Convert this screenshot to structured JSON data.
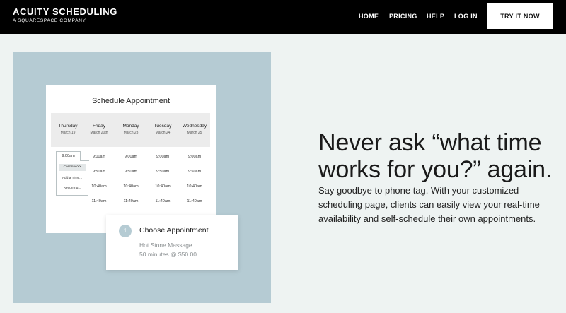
{
  "header": {
    "brand_name": "ACUITY SCHEDULING",
    "brand_tagline": "A SQUARESPACE COMPANY",
    "nav": [
      {
        "label": "HOME"
      },
      {
        "label": "PRICING"
      },
      {
        "label": "HELP"
      },
      {
        "label": "LOG IN"
      }
    ],
    "cta_label": "TRY IT NOW"
  },
  "illustration": {
    "schedule_title": "Schedule Appointment",
    "days": [
      {
        "name": "Thursday",
        "date": "March 19"
      },
      {
        "name": "Friday",
        "date": "March 20th"
      },
      {
        "name": "Monday",
        "date": "March 23"
      },
      {
        "name": "Tuesday",
        "date": "March 24"
      },
      {
        "name": "Wednesday",
        "date": "March 25"
      }
    ],
    "times": [
      "9:00am",
      "9:50am",
      "10:40am",
      "11:40am"
    ],
    "dropdown": {
      "selected_time": "9:00am",
      "options": [
        "Continue>>",
        "Add a Time...",
        "Recurring..."
      ]
    },
    "choose": {
      "step": "1",
      "title": "Choose Appointment",
      "service": "Hot Stone Massage",
      "price_line": "50 minutes @ $50.00"
    }
  },
  "hero": {
    "headline": "Never ask “what time works for you?” again.",
    "subcopy": "Say goodbye to phone tag. With your customized scheduling page, clients can easily view your real-time availability and self-schedule their own appointments."
  },
  "colors": {
    "nav_background": "#000000",
    "page_background": "#eef3f2",
    "panel_accent": "#b5cbd3"
  }
}
